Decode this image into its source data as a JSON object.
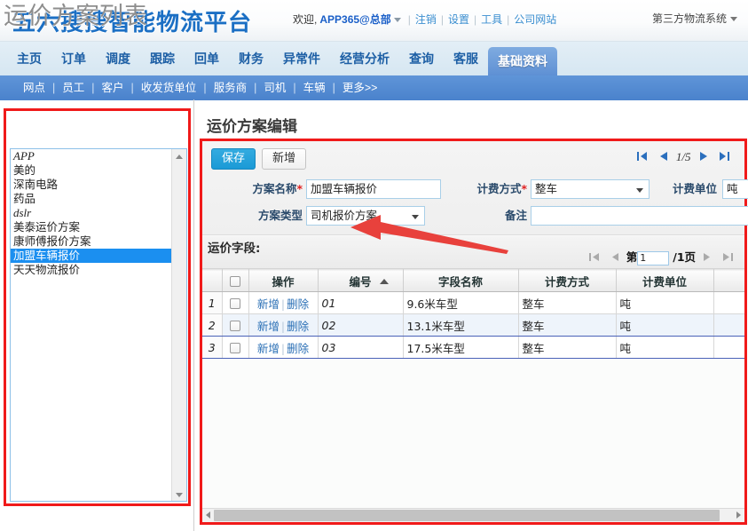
{
  "header": {
    "logo": "五六搜搜智能物流平台",
    "welcome_label": "欢迎,",
    "username": "APP365@总部",
    "links": [
      "注销",
      "设置",
      "工具",
      "公司网站"
    ],
    "system_label": "第三方物流系统",
    "brand_color": "#1b6fc4"
  },
  "nav": {
    "items": [
      "主页",
      "订单",
      "调度",
      "跟踪",
      "回单",
      "财务",
      "异常件",
      "经营分析",
      "查询",
      "客服",
      "基础资料"
    ],
    "active": "基础资料",
    "active_color": "#5e90d4"
  },
  "subnav": {
    "items": [
      "网点",
      "员工",
      "客户",
      "收发货单位",
      "服务商",
      "司机",
      "车辆",
      "更多>>"
    ]
  },
  "sidebar": {
    "title": "运价方案列表",
    "items": [
      {
        "label": "APP",
        "latin": true,
        "selected": false
      },
      {
        "label": "美的",
        "latin": false,
        "selected": false
      },
      {
        "label": "深南电路",
        "latin": false,
        "selected": false
      },
      {
        "label": "药品",
        "latin": false,
        "selected": false
      },
      {
        "label": "dslr",
        "latin": true,
        "selected": false
      },
      {
        "label": "美泰运价方案",
        "latin": false,
        "selected": false
      },
      {
        "label": "康师傅报价方案",
        "latin": false,
        "selected": false
      },
      {
        "label": "加盟车辆报价",
        "latin": false,
        "selected": true
      },
      {
        "label": "天天物流报价",
        "latin": false,
        "selected": false
      }
    ],
    "selection_color": "#1b8ff0"
  },
  "editor": {
    "title": "运价方案编辑",
    "save_label": "保存",
    "new_label": "新增",
    "pager": {
      "current": "1/5"
    },
    "fields": {
      "name_label": "方案名称",
      "name_value": "加盟车辆报价",
      "type_label": "方案类型",
      "type_value": "司机报价方案",
      "billing_method_label": "计费方式",
      "billing_method_value": "整车",
      "billing_unit_label": "计费单位",
      "billing_unit_value": "吨",
      "remark_label": "备注",
      "remark_value": ""
    },
    "required_marker": "*"
  },
  "grid": {
    "title": "运价字段:",
    "pager": {
      "prefix": "第",
      "page_value": "1",
      "suffix": "/1页"
    },
    "columns": [
      "",
      "",
      "操作",
      "编号",
      "字段名称",
      "计费方式",
      "计费单位"
    ],
    "sort_column": "编号",
    "op_add": "新增",
    "op_del": "删除",
    "op_sep": "|",
    "rows": [
      {
        "num": "1",
        "id": "01",
        "field_name": "9.6米车型",
        "billing_method": "整车",
        "billing_unit": "吨"
      },
      {
        "num": "2",
        "id": "02",
        "field_name": "13.1米车型",
        "billing_method": "整车",
        "billing_unit": "吨"
      },
      {
        "num": "3",
        "id": "03",
        "field_name": "17.5米车型",
        "billing_method": "整车",
        "billing_unit": "吨"
      }
    ]
  },
  "annotation": {
    "highlight_color": "#f01a1a",
    "arrow_color": "#e8413c"
  }
}
